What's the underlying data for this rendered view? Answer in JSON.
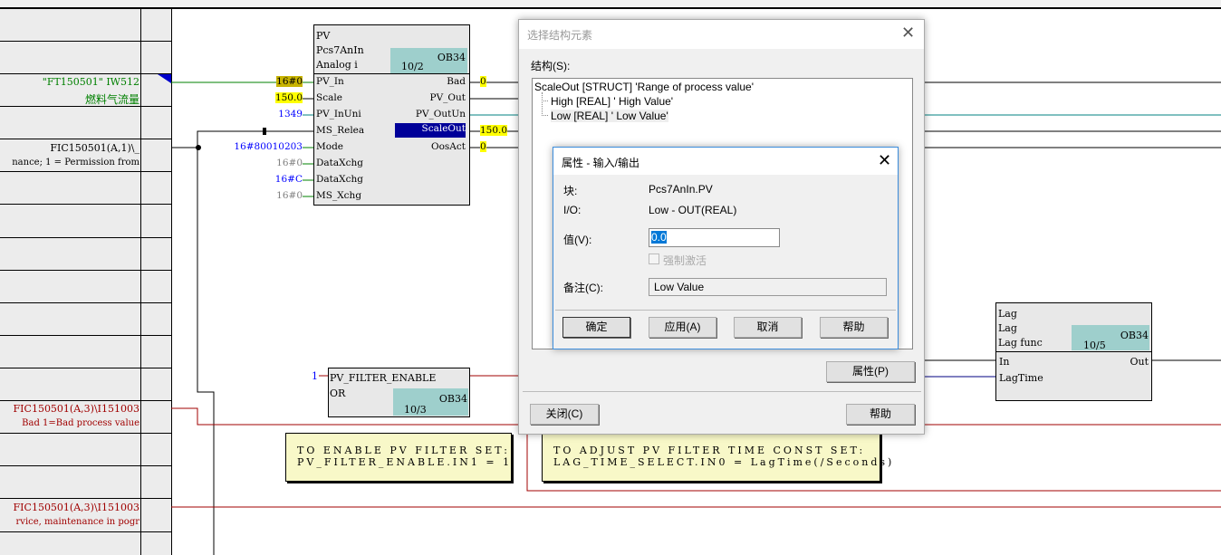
{
  "left_labels": [
    {
      "text": "\"FT150501\" IW512",
      "color": "#008000"
    },
    {
      "text": "燃料气流量",
      "color": "#008000"
    },
    {
      "text": "FIC150501(A,1)\\_",
      "color": "#000000"
    },
    {
      "text": "nance; 1 = Permission from",
      "color": "#000000"
    },
    {
      "text": "FIC150501(A,3)\\I151003",
      "color": "#a00000"
    },
    {
      "text": "Bad 1=Bad process value",
      "color": "#a00000"
    },
    {
      "text": "FIC150501(A,3)\\I151003",
      "color": "#a00000"
    },
    {
      "text": "rvice, maintenance in pogr",
      "color": "#a00000"
    }
  ],
  "pv_block": {
    "name": "PV",
    "type": "Pcs7AnIn",
    "comment": "Analog i",
    "ob": "OB34",
    "seq": "10/2",
    "inputs": [
      {
        "pin": "PV_In",
        "value": "16#0"
      },
      {
        "pin": "Scale",
        "value": "150.0"
      },
      {
        "pin": "PV_InUni",
        "value": "1349"
      },
      {
        "pin": "MS_Relea",
        "value": ""
      },
      {
        "pin": "Mode",
        "value": "16#80010203"
      },
      {
        "pin": "DataXchg",
        "value": "16#0"
      },
      {
        "pin": "DataXchg",
        "value": "16#C"
      },
      {
        "pin": "MS_Xchg",
        "value": "16#0"
      }
    ],
    "outputs": [
      {
        "pin": "Bad",
        "value": "0"
      },
      {
        "pin": "PV_Out",
        "value": ""
      },
      {
        "pin": "PV_OutUn",
        "value": ""
      },
      {
        "pin": "ScaleOut",
        "value": "150.0"
      },
      {
        "pin": "OosAct",
        "value": "0"
      }
    ]
  },
  "filter_block": {
    "name": "PV_FILTER_ENABLE",
    "type": "OR",
    "ob": "OB34",
    "seq": "10/3",
    "input_value": "1"
  },
  "lag_block": {
    "name": "Lag",
    "type": "Lag",
    "comment": "Lag func",
    "ob": "OB34",
    "seq": "10/5",
    "inputs": [
      "In",
      "LagTime"
    ],
    "outputs": [
      "Out"
    ]
  },
  "notes": [
    "TO ENABLE PV FILTER SET:\nPV_FILTER_ENABLE.IN1 = 1",
    "TO ADJUST PV FILTER TIME CONST SET:\nLAG_TIME_SELECT.IN0 = LagTime(/Seconds)"
  ],
  "struct_dialog": {
    "title": "选择结构元素",
    "label": "结构(S):",
    "tree": [
      "ScaleOut [STRUCT] 'Range of process value'",
      "High [REAL] ' High Value'",
      "Low [REAL] ' Low Value'"
    ],
    "properties_button": "属性(P)",
    "close_button": "关闭(C)",
    "help_button": "帮助"
  },
  "prop_dialog": {
    "title": "属性 - 输入/输出",
    "block_label": "块:",
    "block_value": "Pcs7AnIn.PV",
    "io_label": "I/O:",
    "io_value": "Low  -  OUT(REAL)",
    "value_label": "值(V):",
    "value": "0.0",
    "force_label": "强制激活",
    "comment_label": "备注(C):",
    "comment_value": "Low Value",
    "ok": "确定",
    "apply": "应用(A)",
    "cancel": "取消",
    "help": "帮助"
  }
}
